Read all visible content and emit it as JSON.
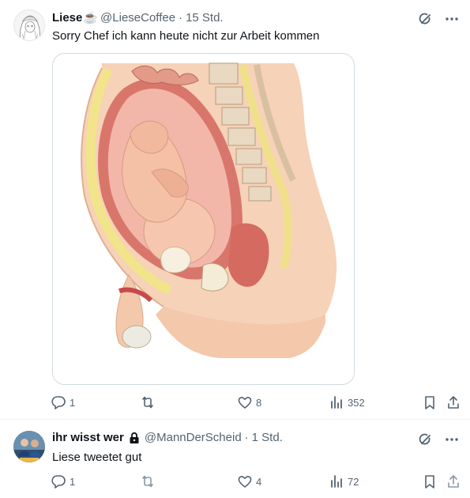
{
  "tweets": [
    {
      "display_name": "Liese",
      "name_emoji": "☕",
      "handle": "@LieseCoffee",
      "separator": "·",
      "time": "15 Std.",
      "text": "Sorry Chef ich kann heute nicht zur Arbeit kommen",
      "media": "anatomical illustration of a pregnant body cross-section",
      "stats": {
        "replies": "1",
        "retweets": "",
        "likes": "8",
        "views": "352"
      }
    },
    {
      "display_name": "ihr wisst wer",
      "handle": "@MannDerScheid",
      "separator": "·",
      "time": "1 Std.",
      "text": "Liese tweetet gut",
      "protected": true,
      "stats": {
        "replies": "1",
        "retweets": "",
        "likes": "4",
        "views": "72"
      }
    }
  ],
  "icons": {
    "header": [
      "grok-icon",
      "more-icon"
    ],
    "actions": [
      "reply-icon",
      "retweet-icon",
      "like-icon",
      "views-icon",
      "bookmark-icon",
      "share-icon"
    ]
  },
  "colors": {
    "text": "#0f1419",
    "secondary": "#536471",
    "border": "#cfd9de",
    "divider": "#eff3f4"
  }
}
